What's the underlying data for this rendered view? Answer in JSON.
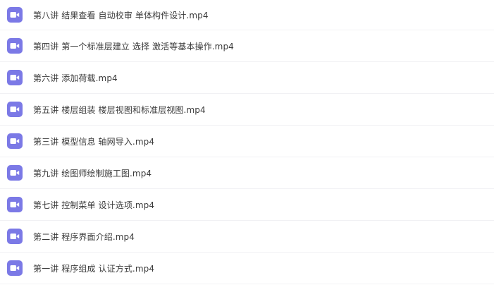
{
  "colors": {
    "icon_bg": "#7b79e6",
    "icon_fg": "#ffffff",
    "text": "#3b3b3b",
    "divider": "#f1f1f4"
  },
  "files": [
    {
      "icon": "video-file-icon",
      "name": "第八讲 结果查看 自动校审 单体构件设计.mp4"
    },
    {
      "icon": "video-file-icon",
      "name": "第四讲 第一个标准层建立 选择 激活等基本操作.mp4"
    },
    {
      "icon": "video-file-icon",
      "name": "第六讲 添加荷载.mp4"
    },
    {
      "icon": "video-file-icon",
      "name": "第五讲 楼层组装 楼层视图和标准层视图.mp4"
    },
    {
      "icon": "video-file-icon",
      "name": "第三讲 模型信息 轴网导入.mp4"
    },
    {
      "icon": "video-file-icon",
      "name": "第九讲 绘图师绘制施工图.mp4"
    },
    {
      "icon": "video-file-icon",
      "name": "第七讲 控制菜单 设计选项.mp4"
    },
    {
      "icon": "video-file-icon",
      "name": "第二讲 程序界面介绍.mp4"
    },
    {
      "icon": "video-file-icon",
      "name": "第一讲 程序组成 认证方式.mp4"
    }
  ]
}
